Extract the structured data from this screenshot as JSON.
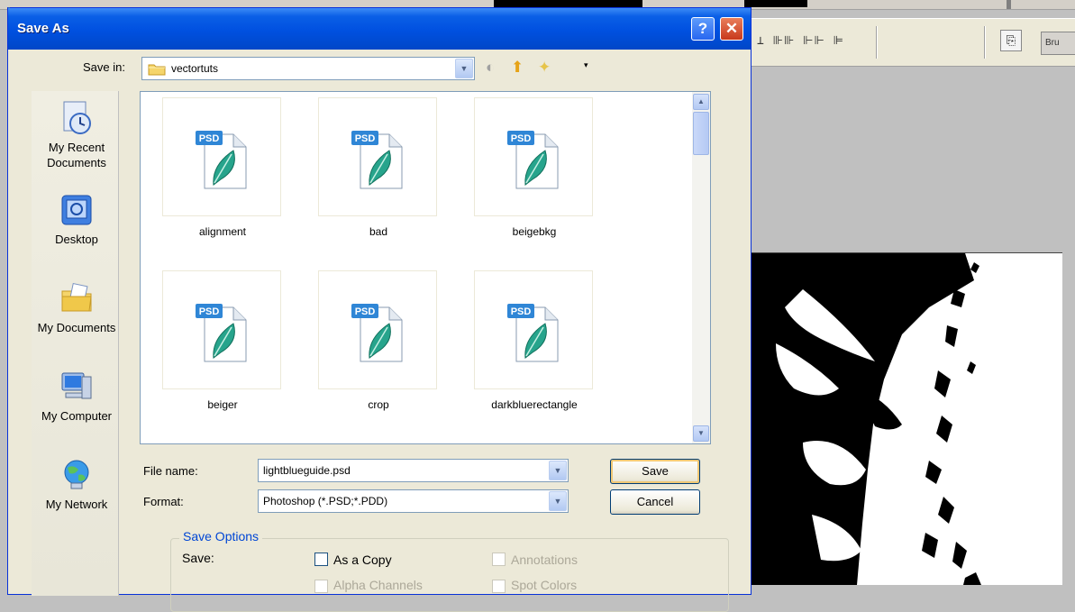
{
  "dialog": {
    "title": "Save As",
    "help_glyph": "?",
    "close_glyph": "✕"
  },
  "save_in": {
    "label": "Save in:",
    "value": "vectortuts"
  },
  "places": [
    {
      "label_line1": "My Recent",
      "label_line2": "Documents",
      "icon": "recent-documents-icon"
    },
    {
      "label_line1": "Desktop",
      "label_line2": "",
      "icon": "desktop-icon"
    },
    {
      "label_line1": "My Documents",
      "label_line2": "",
      "icon": "my-documents-icon"
    },
    {
      "label_line1": "My Computer",
      "label_line2": "",
      "icon": "my-computer-icon"
    },
    {
      "label_line1": "My Network",
      "label_line2": "",
      "icon": "my-network-icon"
    }
  ],
  "files": [
    {
      "name": "alignment",
      "icon_badge": "PSD"
    },
    {
      "name": "bad",
      "icon_badge": "PSD"
    },
    {
      "name": "beigebkg",
      "icon_badge": "PSD"
    },
    {
      "name": "beiger",
      "icon_badge": "PSD"
    },
    {
      "name": "crop",
      "icon_badge": "PSD"
    },
    {
      "name": "darkbluerectangle",
      "icon_badge": "PSD"
    }
  ],
  "file_name": {
    "label": "File name:",
    "value": "lightblueguide.psd"
  },
  "format": {
    "label": "Format:",
    "value": "Photoshop (*.PSD;*.PDD)"
  },
  "buttons": {
    "save": "Save",
    "cancel": "Cancel"
  },
  "save_options": {
    "legend": "Save Options",
    "save_label": "Save:",
    "as_a_copy": "As a Copy",
    "annotations": "Annotations",
    "alpha_channels": "Alpha Channels",
    "spot_colors": "Spot Colors"
  },
  "background_app": {
    "brush_tab": "Bru",
    "align_glyphs": "⊥ ⊪⊪ ⊩⊩ ⊫"
  },
  "colors": {
    "titlebar": "#0050e0",
    "dialog_bg": "#ece9d8",
    "legend_text": "#0046d5"
  }
}
